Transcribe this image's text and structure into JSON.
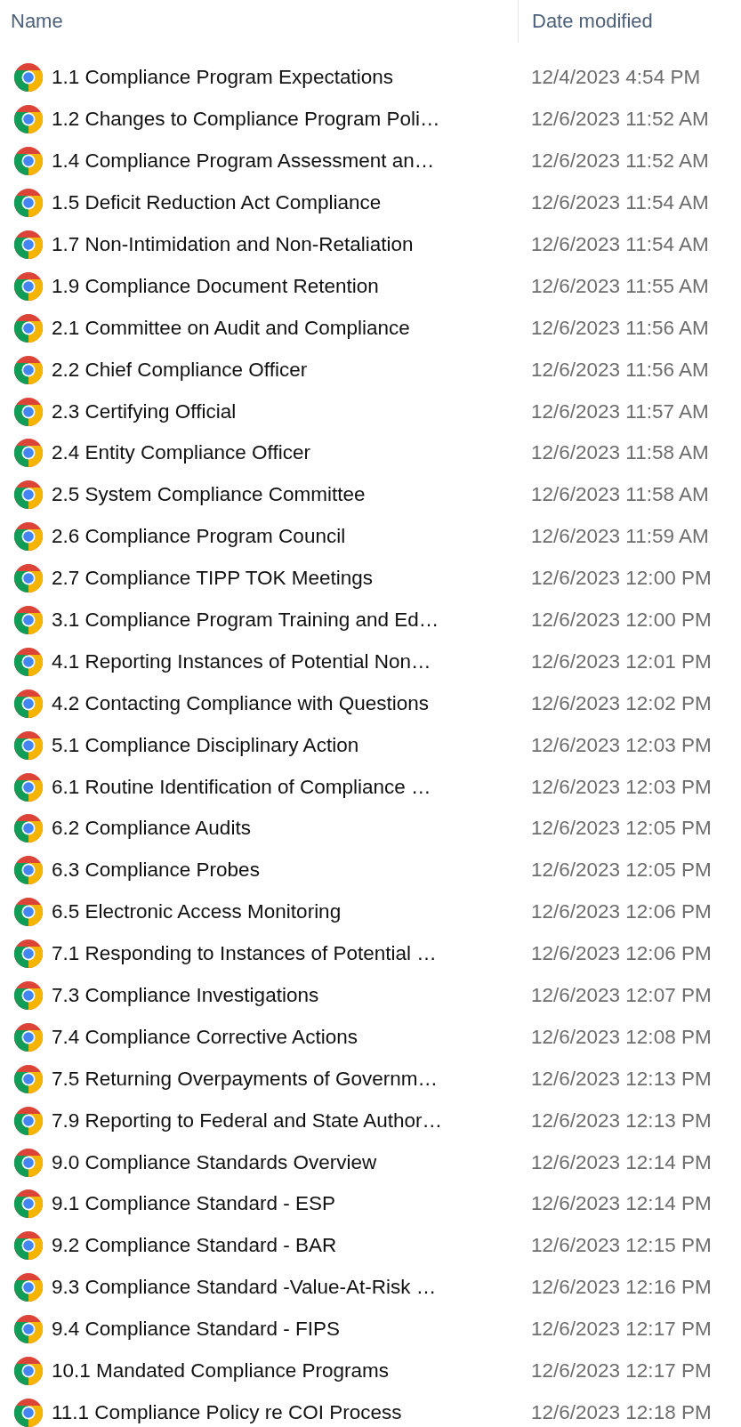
{
  "columns": [
    {
      "label": "Name"
    },
    {
      "label": "Date modified"
    }
  ],
  "files": [
    {
      "name": "1.1 Compliance Program Expectations",
      "date_modified": "12/4/2023 4:54 PM"
    },
    {
      "name": "1.2 Changes to Compliance Program Poli…",
      "date_modified": "12/6/2023 11:52 AM"
    },
    {
      "name": "1.4 Compliance Program Assessment an…",
      "date_modified": "12/6/2023 11:52 AM"
    },
    {
      "name": "1.5 Deficit Reduction Act Compliance",
      "date_modified": "12/6/2023 11:54 AM"
    },
    {
      "name": "1.7 Non-Intimidation and Non-Retaliation",
      "date_modified": "12/6/2023 11:54 AM"
    },
    {
      "name": "1.9 Compliance Document Retention",
      "date_modified": "12/6/2023 11:55 AM"
    },
    {
      "name": "2.1 Committee on Audit and Compliance",
      "date_modified": "12/6/2023 11:56 AM"
    },
    {
      "name": "2.2 Chief Compliance Officer",
      "date_modified": "12/6/2023 11:56 AM"
    },
    {
      "name": "2.3 Certifying Official",
      "date_modified": "12/6/2023 11:57 AM"
    },
    {
      "name": "2.4 Entity Compliance Officer",
      "date_modified": "12/6/2023 11:58 AM"
    },
    {
      "name": "2.5 System Compliance Committee",
      "date_modified": "12/6/2023 11:58 AM"
    },
    {
      "name": "2.6 Compliance Program Council",
      "date_modified": "12/6/2023 11:59 AM"
    },
    {
      "name": "2.7 Compliance TIPP TOK Meetings",
      "date_modified": "12/6/2023 12:00 PM"
    },
    {
      "name": "3.1 Compliance Program Training and Ed…",
      "date_modified": "12/6/2023 12:00 PM"
    },
    {
      "name": "4.1 Reporting Instances of Potential Non…",
      "date_modified": "12/6/2023 12:01 PM"
    },
    {
      "name": "4.2 Contacting Compliance with Questions",
      "date_modified": "12/6/2023 12:02 PM"
    },
    {
      "name": "5.1 Compliance Disciplinary Action",
      "date_modified": "12/6/2023 12:03 PM"
    },
    {
      "name": "6.1 Routine Identification of Compliance …",
      "date_modified": "12/6/2023 12:03 PM"
    },
    {
      "name": "6.2 Compliance Audits",
      "date_modified": "12/6/2023 12:05 PM"
    },
    {
      "name": "6.3 Compliance Probes",
      "date_modified": "12/6/2023 12:05 PM"
    },
    {
      "name": "6.5 Electronic Access Monitoring",
      "date_modified": "12/6/2023 12:06 PM"
    },
    {
      "name": "7.1 Responding to Instances of Potential …",
      "date_modified": "12/6/2023 12:06 PM"
    },
    {
      "name": "7.3 Compliance Investigations",
      "date_modified": "12/6/2023 12:07 PM"
    },
    {
      "name": "7.4 Compliance Corrective Actions",
      "date_modified": "12/6/2023 12:08 PM"
    },
    {
      "name": "7.5 Returning Overpayments of Governm…",
      "date_modified": "12/6/2023 12:13 PM"
    },
    {
      "name": "7.9 Reporting to Federal and State Author…",
      "date_modified": "12/6/2023 12:13 PM"
    },
    {
      "name": "9.0 Compliance Standards Overview",
      "date_modified": "12/6/2023 12:14 PM"
    },
    {
      "name": "9.1 Compliance Standard - ESP",
      "date_modified": "12/6/2023 12:14 PM"
    },
    {
      "name": "9.2 Compliance Standard - BAR",
      "date_modified": "12/6/2023 12:15 PM"
    },
    {
      "name": "9.3 Compliance Standard -Value-At-Risk …",
      "date_modified": "12/6/2023 12:16 PM"
    },
    {
      "name": "9.4 Compliance Standard - FIPS",
      "date_modified": "12/6/2023 12:17 PM"
    },
    {
      "name": "10.1 Mandated Compliance Programs",
      "date_modified": "12/6/2023 12:17 PM"
    },
    {
      "name": "11.1 Compliance Policy re COI Process",
      "date_modified": "12/6/2023 12:18 PM"
    }
  ]
}
